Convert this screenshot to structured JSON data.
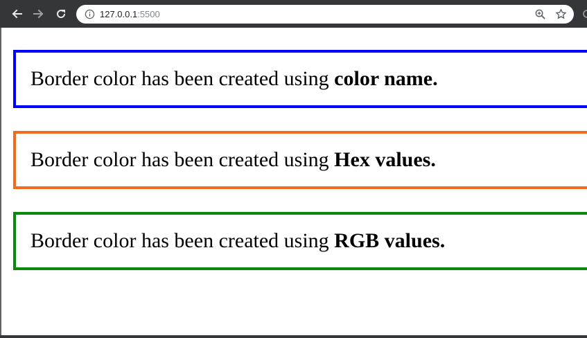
{
  "browser": {
    "url_host": "127.0.0.1",
    "url_port": ":5500"
  },
  "boxes": [
    {
      "text": "Border color has been created using ",
      "bold": "color name.",
      "border_color": "#0000ff"
    },
    {
      "text": "Border color has been created using ",
      "bold": "Hex values.",
      "border_color": "#f26a1b"
    },
    {
      "text": "Border color has been created using ",
      "bold": "RGB values.",
      "border_color": "#0a8a0a"
    }
  ],
  "icons": {
    "back": "arrow-left-icon",
    "forward": "arrow-right-icon",
    "reload": "reload-icon",
    "info": "info-icon",
    "zoom": "zoom-icon",
    "bookmark": "star-icon"
  }
}
